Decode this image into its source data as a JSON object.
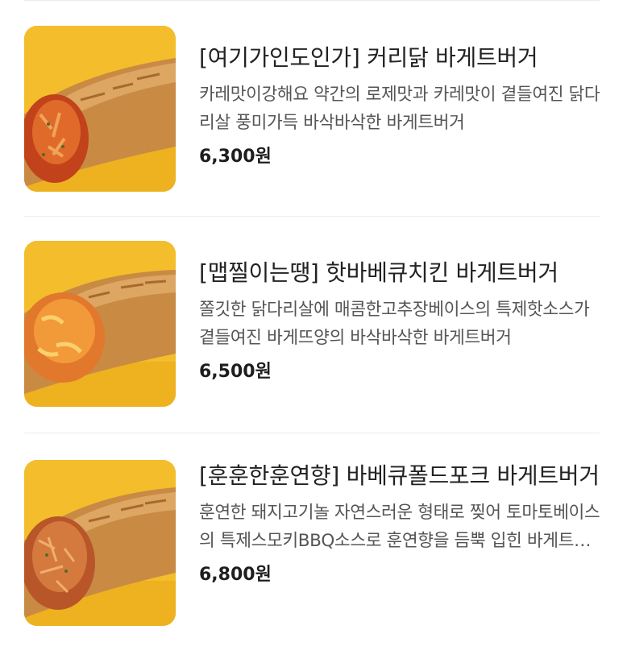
{
  "menu": {
    "items": [
      {
        "title": "[여기가인도인가] 커리닭 바게트버거",
        "description": "카레맛이강해요 약간의 로제맛과 카레맛이 곁들여진 닭다리살 풍미가득 바삭바삭한 바게트버거",
        "price": "6,300원",
        "image_icon": "curry-chicken-baguette-burger-image"
      },
      {
        "title": "[맵찔이는땡] 핫바베큐치킨 바게트버거",
        "description": "쫄깃한 닭다리살에 매콤한고추장베이스의 특제핫소스가 곁들여진 바게뜨양의 바삭바삭한 바게트버거",
        "price": "6,500원",
        "image_icon": "hot-bbq-chicken-baguette-burger-image"
      },
      {
        "title": "[훈훈한훈연향] 바베큐폴드포크 바게트버거",
        "description": "훈연한 돼지고기놀 자연스러운 형태로 찢어 토마토베이스의 특제스모키BBQ소스로 훈연향을 듬뿍 입힌 바게트버거",
        "price": "6,800원",
        "image_icon": "bbq-pulled-pork-baguette-burger-image"
      }
    ]
  },
  "colors": {
    "background": "#ffffff",
    "thumb_background": "#f3bd2c",
    "divider": "#ececec",
    "title_text": "#222222",
    "desc_text": "#555555",
    "price_text": "#1e1e1e"
  }
}
